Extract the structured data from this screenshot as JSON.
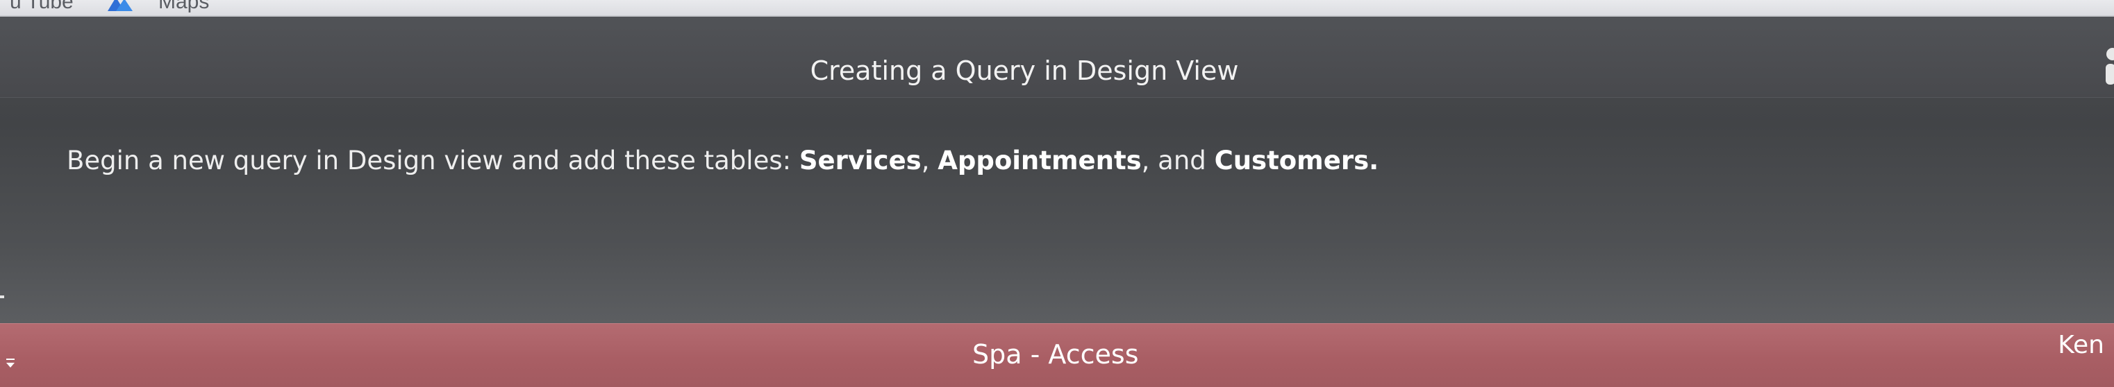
{
  "browser": {
    "bookmarks": [
      {
        "label": "u Tube",
        "icon": "youtube-icon"
      },
      {
        "label": "Maps",
        "icon": "maps-icon"
      }
    ]
  },
  "panel": {
    "title": "Creating a Query in Design View",
    "instruction": {
      "prefix": "Begin a new query in Design view and add these tables: ",
      "table1": "Services",
      "sep1": ", ",
      "table2": "Appointments",
      "sep2": ", and ",
      "table3": "Customers",
      "suffix": "."
    }
  },
  "titlebar": {
    "app_title": "Spa - Access",
    "user_name": "Ken",
    "qat_icon": "customize-quick-access-toolbar-icon"
  },
  "colors": {
    "panel_background": "#46484b",
    "titlebar_access": "#a95e64",
    "text": "#ffffff"
  }
}
